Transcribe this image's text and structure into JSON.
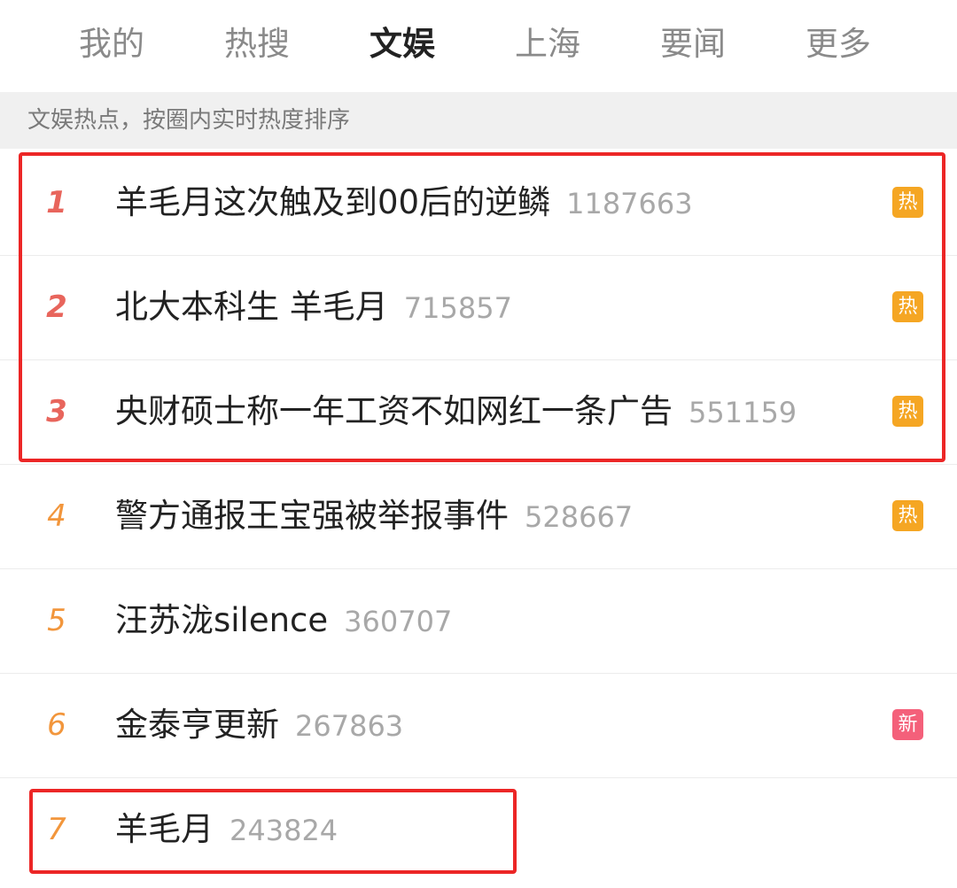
{
  "tabs": [
    {
      "label": "我的"
    },
    {
      "label": "热搜"
    },
    {
      "label": "文娱",
      "active": true
    },
    {
      "label": "上海"
    },
    {
      "label": "要闻"
    },
    {
      "label": "更多"
    }
  ],
  "subheader": {
    "text": "文娱热点，按圈内实时热度排序"
  },
  "items": [
    {
      "rank": "1",
      "title": "羊毛月这次触及到00后的逆鳞",
      "heat": "1187663",
      "badge": "热",
      "badge_type": "hot"
    },
    {
      "rank": "2",
      "title": "北大本科生 羊毛月",
      "heat": "715857",
      "badge": "热",
      "badge_type": "hot"
    },
    {
      "rank": "3",
      "title": "央财硕士称一年工资不如网红一条广告",
      "heat": "551159",
      "badge": "热",
      "badge_type": "hot"
    },
    {
      "rank": "4",
      "title": "警方通报王宝强被举报事件",
      "heat": "528667",
      "badge": "热",
      "badge_type": "hot"
    },
    {
      "rank": "5",
      "title": "汪苏泷silence",
      "heat": "360707",
      "badge": "",
      "badge_type": ""
    },
    {
      "rank": "6",
      "title": "金泰亨更新",
      "heat": "267863",
      "badge": "新",
      "badge_type": "new"
    },
    {
      "rank": "7",
      "title": "羊毛月",
      "heat": "243824",
      "badge": "",
      "badge_type": ""
    }
  ],
  "colors": {
    "accent": "#f06a24",
    "top_rank": "#e8655c",
    "other_rank": "#f2963c",
    "hot_badge": "#f5a623",
    "new_badge": "#f4607a",
    "highlight_box": "#ec2626"
  }
}
